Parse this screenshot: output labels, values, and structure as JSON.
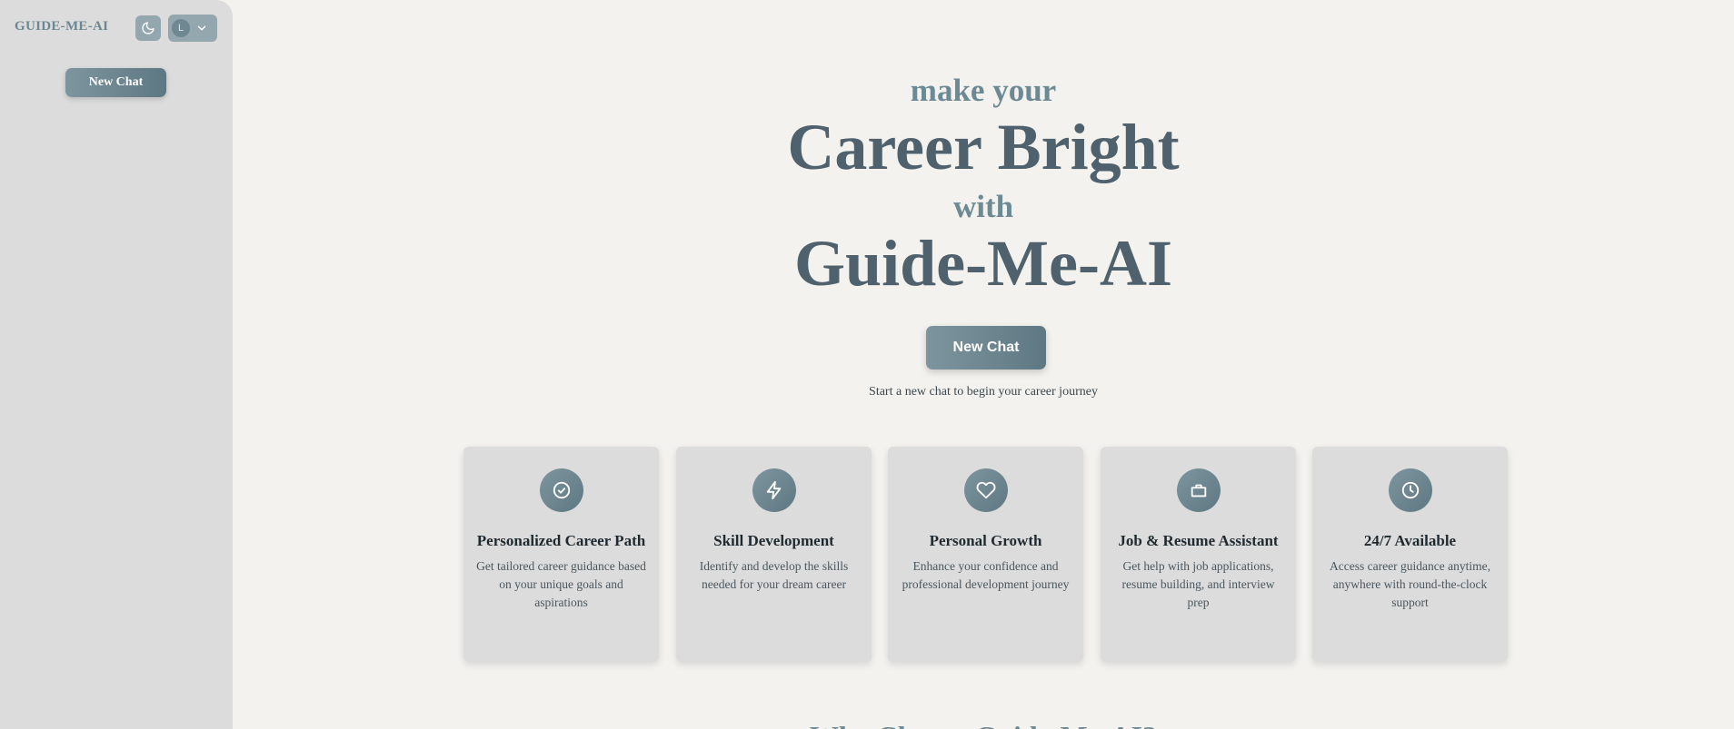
{
  "sidebar": {
    "brand": "GUIDE-ME-AI",
    "theme_icon": "moon-icon",
    "user_initial": "L",
    "new_chat_label": "New Chat"
  },
  "hero": {
    "line1": "make your",
    "line2": "Career Bright",
    "line3": "with",
    "line4": "Guide-Me-AI",
    "new_chat_label": "New Chat",
    "hint": "Start a new chat to begin your career journey"
  },
  "features": [
    {
      "icon": "check-circle-icon",
      "title": "Personalized Career Path",
      "desc": "Get tailored career guidance based on your unique goals and aspirations"
    },
    {
      "icon": "lightning-icon",
      "title": "Skill Development",
      "desc": "Identify and develop the skills needed for your dream career"
    },
    {
      "icon": "heart-icon",
      "title": "Personal Growth",
      "desc": "Enhance your confidence and professional development journey"
    },
    {
      "icon": "briefcase-icon",
      "title": "Job & Resume Assistant",
      "desc": "Get help with job applications, resume building, and interview prep"
    },
    {
      "icon": "clock-icon",
      "title": "24/7 Available",
      "desc": "Access career guidance anytime, anywhere with round-the-clock support"
    }
  ],
  "next_section": {
    "heading": "Why Choose Guide-Me-AI?"
  },
  "colors": {
    "accent": "#6d8a94",
    "heading_dark": "#4f616c",
    "background": "#f3f2ee",
    "sidebar": "#dcdcdc"
  }
}
